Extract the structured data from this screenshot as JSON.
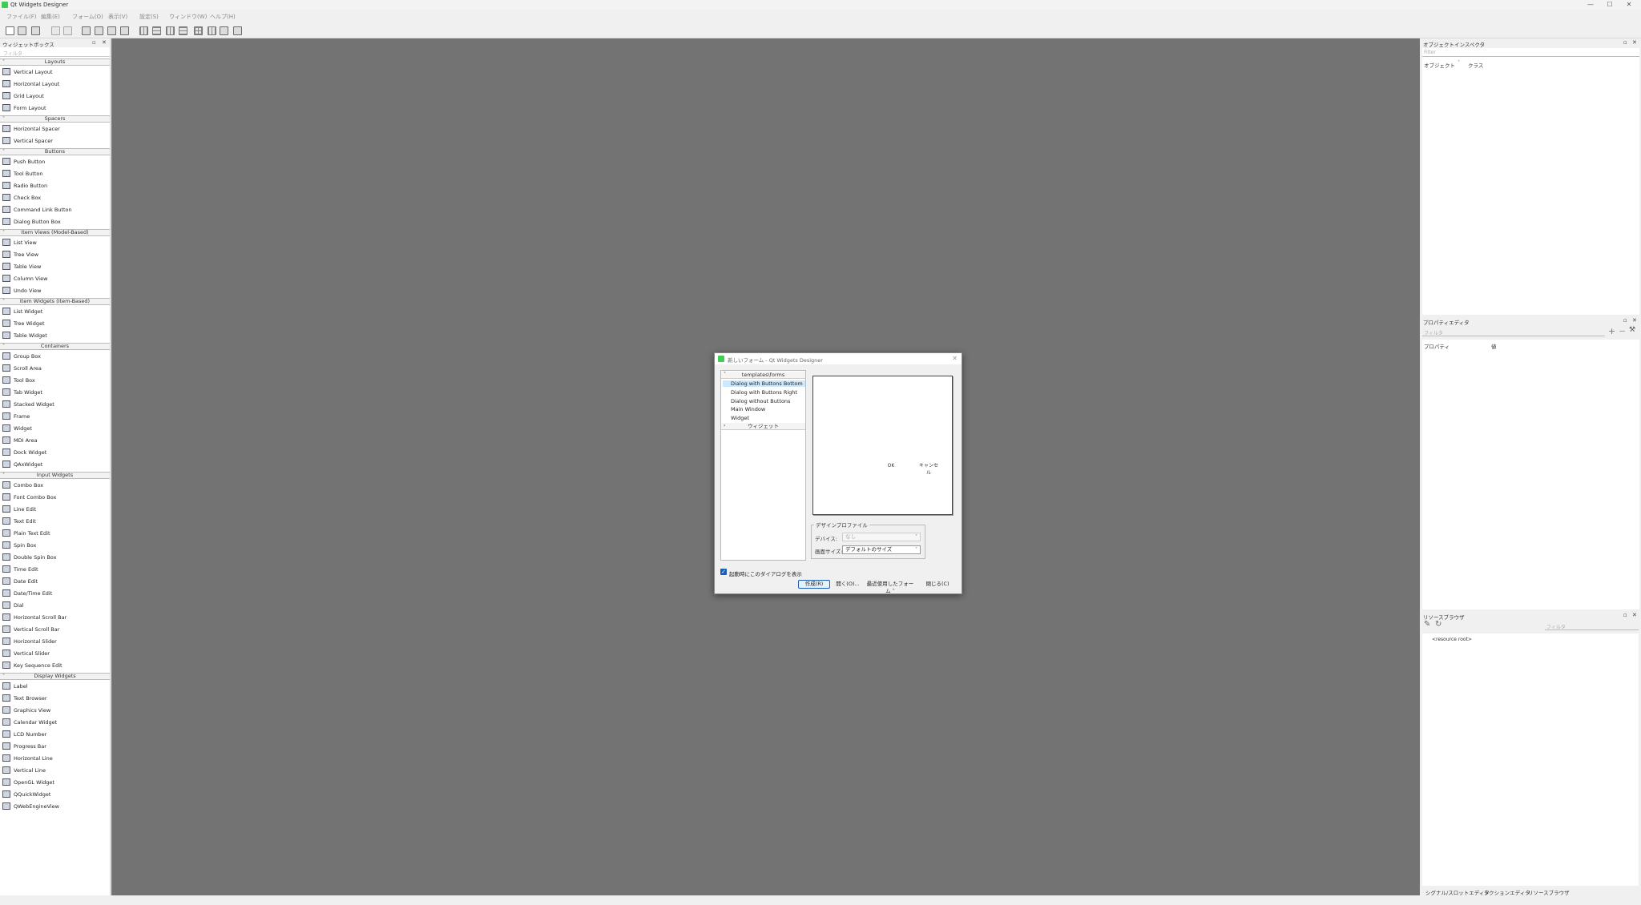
{
  "window": {
    "title": "Qt Widgets Designer",
    "minimize_glyph": "—",
    "maximize_glyph": "☐",
    "close_glyph": "✕"
  },
  "menubar": {
    "items": [
      "ファイル(F)",
      "編集(E)",
      "フォーム(O)",
      "表示(V)",
      "設定(S)",
      "ウィンドウ(W)",
      "ヘルプ(H)"
    ]
  },
  "toolbar": {
    "icons": [
      "new-form-icon",
      "open-form-icon",
      "save-form-icon",
      "undo-icon",
      "redo-icon",
      "edit-widgets-icon",
      "edit-signals-slots-icon",
      "edit-buddies-icon",
      "edit-tab-order-icon",
      "layout-horizontal-icon",
      "layout-vertical-icon",
      "layout-horizontal-splitter-icon",
      "layout-vertical-splitter-icon",
      "layout-grid-icon",
      "layout-form-icon",
      "break-layout-icon",
      "adjust-size-icon"
    ]
  },
  "widget_box": {
    "title": "ウィジェットボックス",
    "filter_placeholder": "フィルタ",
    "categories": [
      {
        "name": "Layouts",
        "items": [
          "Vertical Layout",
          "Horizontal Layout",
          "Grid Layout",
          "Form Layout"
        ]
      },
      {
        "name": "Spacers",
        "items": [
          "Horizontal Spacer",
          "Vertical Spacer"
        ]
      },
      {
        "name": "Buttons",
        "items": [
          "Push Button",
          "Tool Button",
          "Radio Button",
          "Check Box",
          "Command Link Button",
          "Dialog Button Box"
        ]
      },
      {
        "name": "Item Views (Model-Based)",
        "items": [
          "List View",
          "Tree View",
          "Table View",
          "Column View",
          "Undo View"
        ]
      },
      {
        "name": "Item Widgets (Item-Based)",
        "items": [
          "List Widget",
          "Tree Widget",
          "Table Widget"
        ]
      },
      {
        "name": "Containers",
        "items": [
          "Group Box",
          "Scroll Area",
          "Tool Box",
          "Tab Widget",
          "Stacked Widget",
          "Frame",
          "Widget",
          "MDI Area",
          "Dock Widget",
          "QAxWidget"
        ]
      },
      {
        "name": "Input Widgets",
        "items": [
          "Combo Box",
          "Font Combo Box",
          "Line Edit",
          "Text Edit",
          "Plain Text Edit",
          "Spin Box",
          "Double Spin Box",
          "Time Edit",
          "Date Edit",
          "Date/Time Edit",
          "Dial",
          "Horizontal Scroll Bar",
          "Vertical Scroll Bar",
          "Horizontal Slider",
          "Vertical Slider",
          "Key Sequence Edit"
        ]
      },
      {
        "name": "Display Widgets",
        "items": [
          "Label",
          "Text Browser",
          "Graphics View",
          "Calendar Widget",
          "LCD Number",
          "Progress Bar",
          "Horizontal Line",
          "Vertical Line",
          "OpenGL Widget",
          "QQuickWidget",
          "QWebEngineView"
        ]
      }
    ]
  },
  "object_inspector": {
    "title": "オブジェクトインスペクタ",
    "filter_placeholder": "Filter",
    "col_object": "オブジェクト",
    "col_class": "クラス"
  },
  "property_editor": {
    "title": "プロパティエディタ",
    "filter_placeholder": "フィルタ",
    "col_property": "プロパティ",
    "col_value": "値",
    "add_glyph": "+",
    "remove_glyph": "−"
  },
  "resource_browser": {
    "title": "リソースブラウザ",
    "filter_placeholder": "フィルタ",
    "root_item": "<resource root>"
  },
  "bottom_tabs": [
    "シグナル/スロットエディタ",
    "アクションエディタ",
    "リソースブラウザ"
  ],
  "new_form_dialog": {
    "title": "新しいフォーム - Qt Widgets Designer",
    "close_glyph": "✕",
    "templates_header": "templates\\forms",
    "templates": [
      "Dialog with Buttons Bottom",
      "Dialog with Buttons Right",
      "Dialog without Buttons",
      "Main Window",
      "Widget"
    ],
    "selected_template": "Dialog with Buttons Bottom",
    "widgets_header": "ウィジェット",
    "preview_ok": "OK",
    "preview_cancel": "キャンセル",
    "design_profile": {
      "legend": "デザインプロファイル",
      "device_label": "デバイス:",
      "device_value": "なし",
      "screen_size_label": "画面サイズ:",
      "screen_size_value": "デフォルトのサイズ"
    },
    "show_on_startup_label": "起動時にこのダイアログを表示",
    "show_on_startup_checked": true,
    "checkmark": "✓",
    "buttons": {
      "create": "作成(R)",
      "open": "開く(O)...",
      "recent": "最近使用したフォーム",
      "close": "閉じる(C)"
    }
  },
  "colors": {
    "canvas": "#737373",
    "qt_green": "#41cd52",
    "accent": "#1a5fb4",
    "selection": "#cce8ff"
  }
}
